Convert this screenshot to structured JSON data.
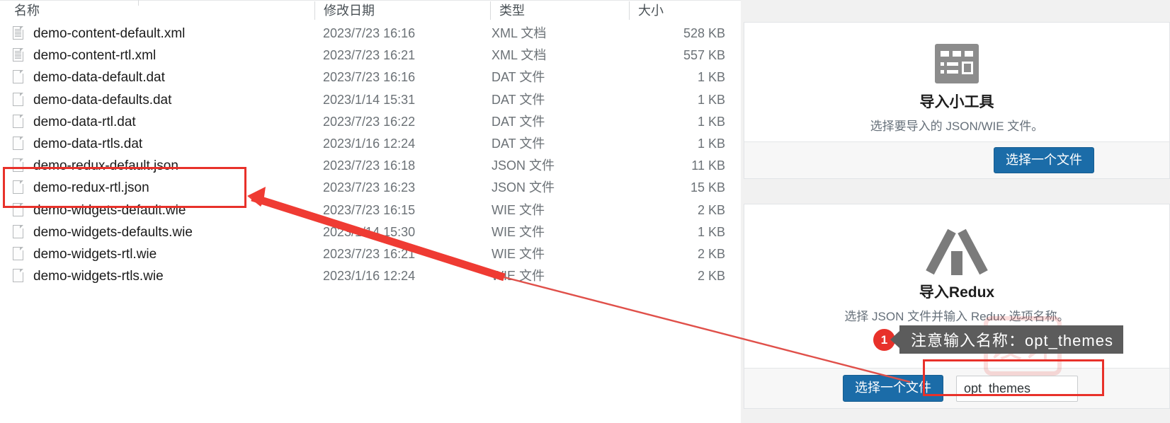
{
  "explorer": {
    "columns": [
      "名称",
      "修改日期",
      "类型",
      "大小"
    ],
    "files": [
      {
        "name": "demo-content-default.xml",
        "icon": "xml-document-icon",
        "date": "2023/7/23 16:16",
        "type": "XML 文档",
        "size": "528 KB"
      },
      {
        "name": "demo-content-rtl.xml",
        "icon": "xml-document-icon",
        "date": "2023/7/23 16:21",
        "type": "XML 文档",
        "size": "557 KB"
      },
      {
        "name": "demo-data-default.dat",
        "icon": "generic-file-icon",
        "date": "2023/7/23 16:16",
        "type": "DAT 文件",
        "size": "1 KB"
      },
      {
        "name": "demo-data-defaults.dat",
        "icon": "generic-file-icon",
        "date": "2023/1/14 15:31",
        "type": "DAT 文件",
        "size": "1 KB"
      },
      {
        "name": "demo-data-rtl.dat",
        "icon": "generic-file-icon",
        "date": "2023/7/23 16:22",
        "type": "DAT 文件",
        "size": "1 KB"
      },
      {
        "name": "demo-data-rtls.dat",
        "icon": "generic-file-icon",
        "date": "2023/1/16 12:24",
        "type": "DAT 文件",
        "size": "1 KB"
      },
      {
        "name": "demo-redux-default.json",
        "icon": "generic-file-icon",
        "date": "2023/7/23 16:18",
        "type": "JSON 文件",
        "size": "11 KB"
      },
      {
        "name": "demo-redux-rtl.json",
        "icon": "generic-file-icon",
        "date": "2023/7/23 16:23",
        "type": "JSON 文件",
        "size": "15 KB"
      },
      {
        "name": "demo-widgets-default.wie",
        "icon": "generic-file-icon",
        "date": "2023/7/23 16:15",
        "type": "WIE 文件",
        "size": "2 KB"
      },
      {
        "name": "demo-widgets-defaults.wie",
        "icon": "generic-file-icon",
        "date": "2023/1/14 15:30",
        "type": "WIE 文件",
        "size": "1 KB"
      },
      {
        "name": "demo-widgets-rtl.wie",
        "icon": "generic-file-icon",
        "date": "2023/7/23 16:21",
        "type": "WIE 文件",
        "size": "2 KB"
      },
      {
        "name": "demo-widgets-rtls.wie",
        "icon": "generic-file-icon",
        "date": "2023/1/16 12:24",
        "type": "WIE 文件",
        "size": "2 KB"
      }
    ]
  },
  "panels": {
    "widgets": {
      "icon": "widget-grid-icon",
      "title": "导入小工具",
      "subtitle": "选择要导入的 JSON/WIE 文件。",
      "button_label": "选择一个文件"
    },
    "redux": {
      "icon": "x-logo-icon",
      "title": "导入Redux",
      "subtitle": "选择 JSON 文件并输入 Redux 选项名称。",
      "button_label": "选择一个文件",
      "input_value": "opt_themes",
      "input_placeholder": "opt_themes"
    }
  },
  "annotations": {
    "step_number": "1",
    "callout_text": "注意输入名称：opt_themes",
    "accent_color": "#e8312a",
    "callout_bg": "#5c5c5c",
    "button_color": "#1b6ca8"
  }
}
